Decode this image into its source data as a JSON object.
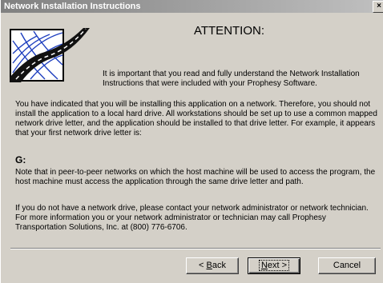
{
  "window": {
    "title": "Network Installation Instructions",
    "close_label": "×"
  },
  "heading": "ATTENTION:",
  "paragraphs": {
    "intro": "It is important that you read and fully understand the Network Installation Instructions that were included with your Prophesy Software.",
    "network": "You have indicated that you will be installing this application on a network.  Therefore, you should not install the application to a local hard drive.  All workstations should be set up to use a common mapped network drive letter, and the application should be installed to that drive letter.  For example, it appears that your first network drive letter is:",
    "drive_letter": "G:",
    "peer": "Note that in peer-to-peer networks on which the host machine will be used to access the program, the host machine must access the application through the same drive letter and path.",
    "contact": "If you do not have a network drive, please contact your network administrator or network technician.  For more information you or your network administrator or technician may call Prophesy Transportation Solutions, Inc. at (800) 776-6706."
  },
  "buttons": {
    "back_prefix": "< ",
    "back_key": "B",
    "back_rest": "ack",
    "next_key": "N",
    "next_rest": "ext >",
    "cancel": "Cancel"
  },
  "icons": {
    "logo": "globe-road-logo-icon",
    "close": "close-icon"
  }
}
